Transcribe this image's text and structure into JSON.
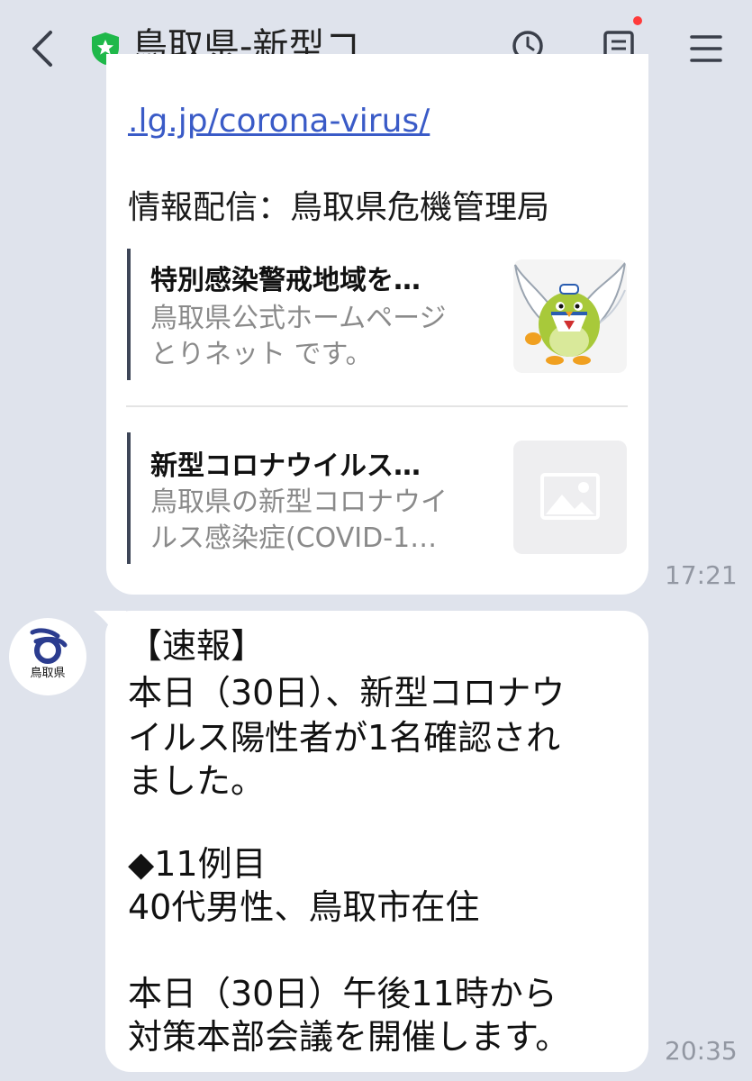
{
  "header": {
    "title": "鳥取県-新型コ…"
  },
  "messages": [
    {
      "link_text": ".lg.jp/corona-virus/",
      "info_line": "情報配信：鳥取県危機管理局",
      "previews": [
        {
          "title": "特別感染警戒地域を…",
          "desc_lines": [
            "鳥取県公式ホームページ",
            "とりネット です。"
          ]
        },
        {
          "title": "新型コロナウイルス…",
          "desc_lines": [
            "鳥取県の新型コロナウイ",
            "ルス感染症(COVID-1…"
          ]
        }
      ],
      "time": "17:21"
    },
    {
      "sender_label": "鳥取県",
      "lines": [
        "【速報】",
        "本日（30日）、新型コロナウ",
        "イルス陽性者が1名確認され",
        "ました。",
        "",
        "◆11例目",
        "40代男性、鳥取市在住",
        "",
        "本日（30日）午後11時から",
        "対策本部会議を開催します。"
      ],
      "time": "20:35"
    }
  ],
  "colors": {
    "background": "#dfe3ec",
    "bubble": "#ffffff",
    "link": "#3a5bc7",
    "shield": "#1fb84a",
    "badge": "#ff3b3b",
    "time": "#9297a2",
    "preview_bar": "#3e4658"
  },
  "icons": [
    "back-arrow-icon",
    "shield-star-icon",
    "search-clock-icon",
    "notes-icon",
    "menu-icon",
    "mascot-bird-image",
    "image-placeholder-icon",
    "tottori-logo-icon"
  ]
}
